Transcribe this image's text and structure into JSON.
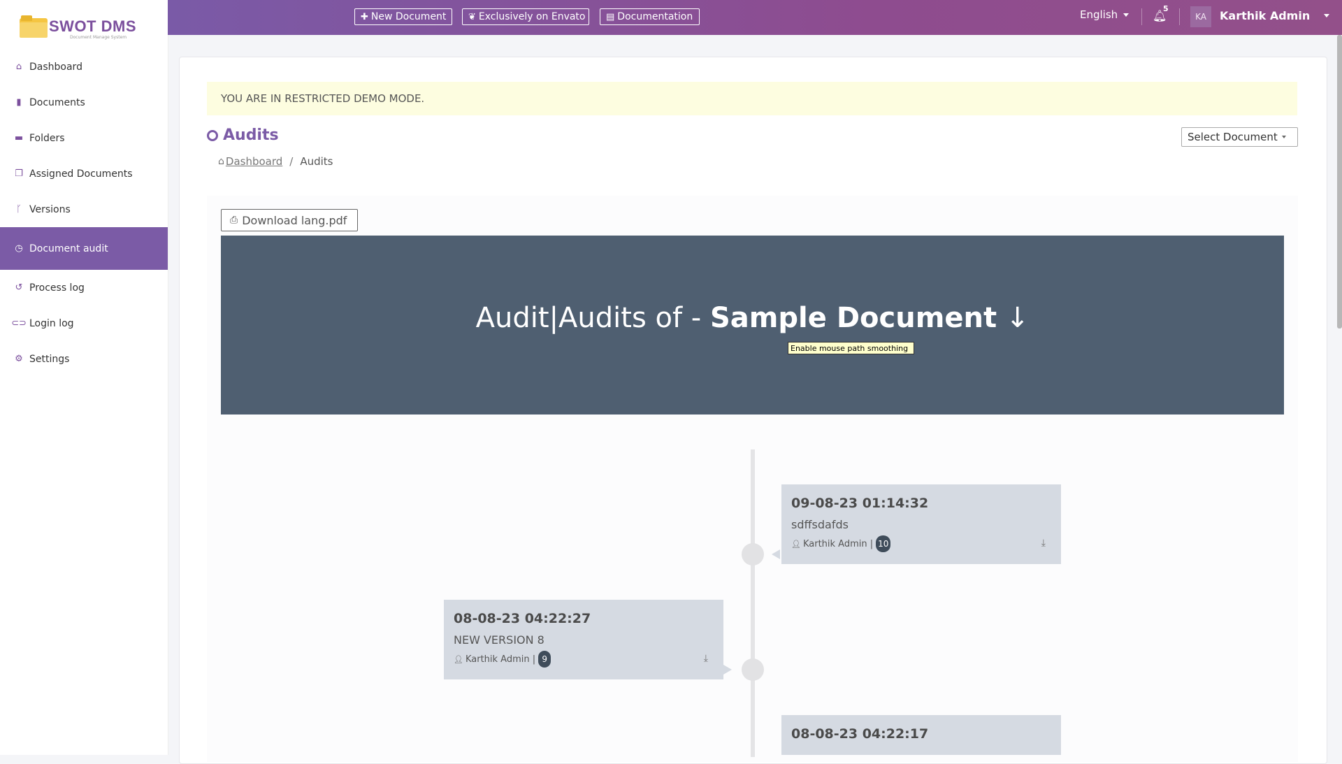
{
  "brand": {
    "name": "SWOT DMS",
    "tagline": "Document Manage System"
  },
  "sidebar": {
    "items": [
      {
        "label": "Dashboard",
        "icon": "home-icon"
      },
      {
        "label": "Documents",
        "icon": "file-icon"
      },
      {
        "label": "Folders",
        "icon": "folder-icon"
      },
      {
        "label": "Assigned Documents",
        "icon": "copy-icon"
      },
      {
        "label": "Versions",
        "icon": "branch-icon"
      },
      {
        "label": "Document audit",
        "icon": "clock-icon",
        "active": true
      },
      {
        "label": "Process log",
        "icon": "history-icon"
      },
      {
        "label": "Login log",
        "icon": "toggle-icon"
      },
      {
        "label": "Settings",
        "icon": "cogs-icon"
      }
    ]
  },
  "topbar": {
    "new_document": "New Document",
    "envato": "Exclusively on Envato",
    "documentation": "Documentation",
    "language": "English",
    "notification_count": "5",
    "avatar_initials": "KA",
    "user_name": "Karthik Admin"
  },
  "alert": "YOU ARE IN RESTRICTED DEMO MODE.",
  "page": {
    "title": "Audits",
    "breadcrumb": {
      "home": "Dashboard",
      "separator": "/",
      "current": "Audits"
    },
    "select_document": "Select Document"
  },
  "download_button": "Download lang.pdf",
  "hero": {
    "prefix": "Audit|Audits of - ",
    "document": "Sample Document",
    "arrow": "↓"
  },
  "tooltip": "Enable mouse path smoothing",
  "timeline": [
    {
      "datetime": "09-08-23 01:14:32",
      "description": "sdffsdafds",
      "user": "Karthik Admin |",
      "version": "10",
      "side": "right"
    },
    {
      "datetime": "08-08-23 04:22:27",
      "description": "NEW VERSION 8",
      "user": "Karthik Admin |",
      "version": "9",
      "side": "left"
    },
    {
      "datetime": "08-08-23 04:22:17",
      "description": "",
      "user": "",
      "version": "",
      "side": "right"
    }
  ],
  "colors": {
    "accent": "#7b5ba6",
    "hero_bg": "#4f5f71",
    "card_bg": "#d5dae2",
    "alert_bg": "#fdfde0"
  }
}
